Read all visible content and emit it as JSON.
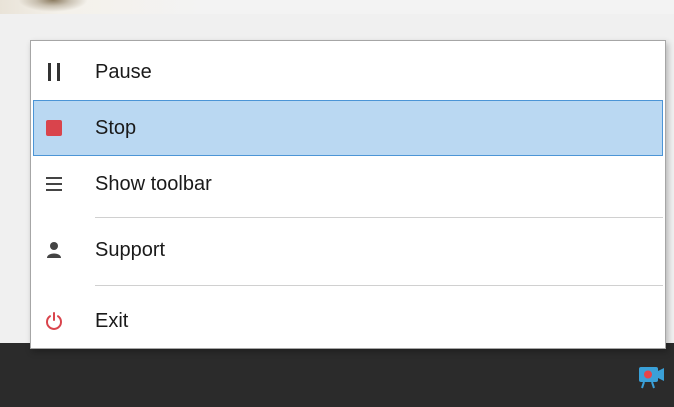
{
  "context_menu": {
    "items": [
      {
        "label": "Pause",
        "icon": "pause-icon",
        "selected": false
      },
      {
        "label": "Stop",
        "icon": "stop-icon",
        "selected": true
      },
      {
        "label": "Show toolbar",
        "icon": "hamburger-icon",
        "selected": false
      },
      {
        "label": "Support",
        "icon": "person-icon",
        "selected": false
      },
      {
        "label": "Exit",
        "icon": "power-icon",
        "selected": false
      }
    ]
  },
  "taskbar": {
    "tray_icon": "screen-recorder-icon"
  },
  "colors": {
    "selection_bg": "#bad8f2",
    "selection_border": "#4c95d6",
    "stop_red": "#d9444c",
    "exit_red": "#d9444c",
    "taskbar": "#2b2b2b",
    "tray_icon_blue": "#3aa0d8"
  }
}
